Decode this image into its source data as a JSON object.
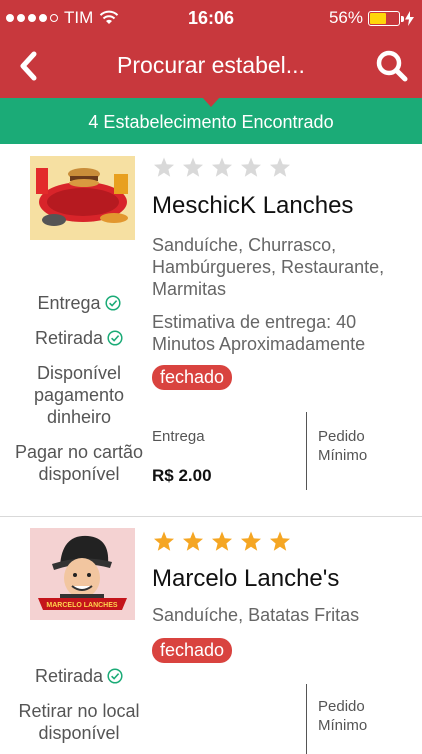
{
  "status_bar": {
    "carrier": "TIM",
    "time": "16:06",
    "battery": "56%",
    "battery_level": 0.56,
    "signal_bars_filled": 4,
    "signal_bars_total": 5
  },
  "nav": {
    "title": "Procurar estabel...",
    "back_icon": "chevron-left-icon",
    "search_icon": "search-icon"
  },
  "banner": {
    "text": "4 Estabelecimento Encontrado"
  },
  "results": [
    {
      "name": "MeschicK Lanches",
      "rating": 0,
      "stars_total": 5,
      "categories": "Sanduíche, Churrasco, Hambúrgueres, Restaurante, Marmitas",
      "estimate": "Estimativa de entrega: 40 Minutos Aproximadamente",
      "status": "fechado",
      "options": [
        {
          "label": "Entrega",
          "check": true
        },
        {
          "label": "Retirada",
          "check": true
        },
        {
          "label": "Disponível pagamento dinheiro",
          "check": false
        },
        {
          "label": "Pagar no cartão disponível",
          "check": false
        }
      ],
      "delivery_label": "Entrega",
      "delivery_price": "R$ 2.00",
      "min_order_label": "Pedido Mínimo"
    },
    {
      "name": "Marcelo Lanche's",
      "rating": 5,
      "stars_total": 5,
      "categories": "Sanduíche, Batatas Fritas",
      "status": "fechado",
      "options": [
        {
          "label": "Retirada",
          "check": true
        },
        {
          "label": "Retirar no local disponível",
          "check": false
        }
      ],
      "min_order_label": "Pedido Mínimo"
    }
  ],
  "colors": {
    "header": "#c8383d",
    "banner": "#1bab77",
    "badge": "#d9433f",
    "star_on": "#f5a623",
    "star_off": "#d9d9d9",
    "check": "#1bab77"
  }
}
